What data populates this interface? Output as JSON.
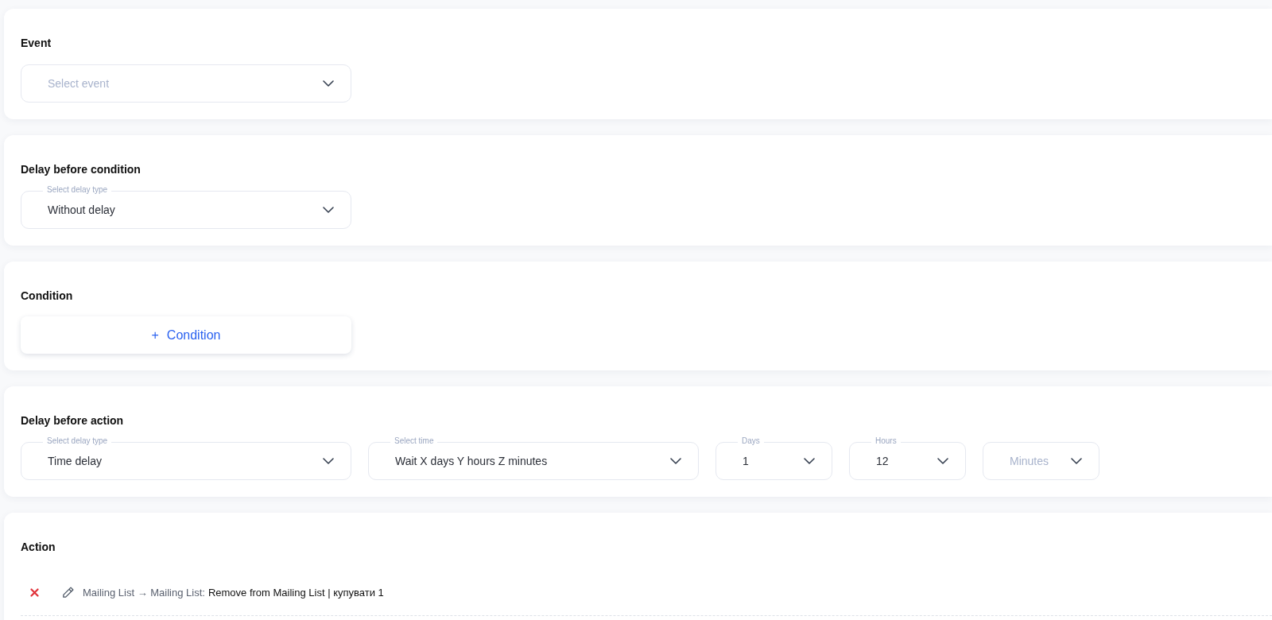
{
  "sections": [
    {
      "title": "Event",
      "kind": "fields",
      "fields": [
        {
          "kind": "wide",
          "placeholder": "Select event"
        }
      ]
    },
    {
      "title": "Delay before condition",
      "kind": "fields",
      "fields": [
        {
          "kind": "wide",
          "label": "Select delay type",
          "value": "Without delay"
        }
      ]
    },
    {
      "title": "Condition",
      "kind": "add",
      "button": {
        "icon": "+",
        "label": "Condition"
      }
    },
    {
      "title": "Delay before action",
      "kind": "fields",
      "fields": [
        {
          "kind": "wide",
          "label": "Select delay type",
          "value": "Time delay"
        },
        {
          "kind": "wide",
          "label": "Select time",
          "value": "Wait X days Y hours Z minutes"
        },
        {
          "kind": "narrow",
          "label": "Days",
          "value": "1"
        },
        {
          "kind": "narrow",
          "label": "Hours",
          "value": "12"
        },
        {
          "kind": "narrow",
          "placeholder": "Minutes"
        }
      ]
    },
    {
      "title": "Action",
      "kind": "actions",
      "actions": [
        {
          "path": "Mailing List → Mailing List:",
          "detail": "Remove from Mailing List | купувати 1"
        }
      ]
    }
  ]
}
